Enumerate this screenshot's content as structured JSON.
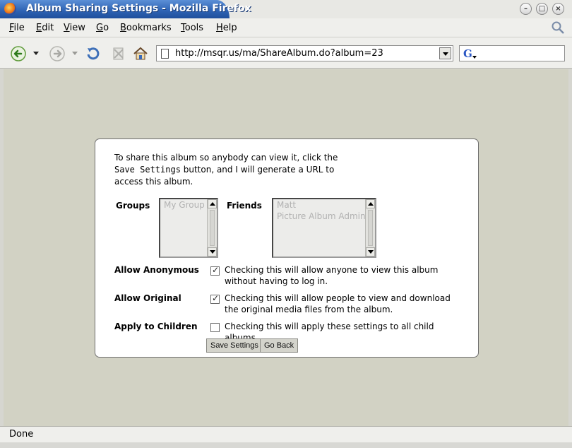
{
  "window": {
    "title": "Album Sharing Settings - Mozilla Firefox",
    "buttons": [
      "minimize",
      "maximize",
      "close"
    ]
  },
  "menubar": {
    "items": [
      {
        "label": "File",
        "key": "F",
        "rest": "ile"
      },
      {
        "label": "Edit",
        "key": "E",
        "rest": "dit"
      },
      {
        "label": "View",
        "key": "V",
        "rest": "iew"
      },
      {
        "label": "Go",
        "key": "G",
        "rest": "o"
      },
      {
        "label": "Bookmarks",
        "key": "B",
        "rest": "ookmarks"
      },
      {
        "label": "Tools",
        "key": "T",
        "rest": "ools"
      },
      {
        "label": "Help",
        "key": "H",
        "rest": "elp"
      }
    ]
  },
  "navbar": {
    "url": "http://msqr.us/ma/ShareAlbum.do?album=23",
    "search_value": ""
  },
  "panel": {
    "intro_pre": "To share this album so anybody can view it, click the ",
    "intro_code": "Save Settings",
    "intro_post": " button, and I will generate a URL to access this album.",
    "groups_label": "Groups",
    "groups_options": [
      "My Group"
    ],
    "friends_label": "Friends",
    "friends_options": [
      "Matt",
      "Picture Album Admin"
    ],
    "options": [
      {
        "label": "Allow Anonymous",
        "checked": true,
        "desc": "Checking this will allow anyone to view this album without having to log in."
      },
      {
        "label": "Allow Original",
        "checked": true,
        "desc": "Checking this will allow people to view and download the original media files from the album."
      },
      {
        "label": "Apply to Children",
        "checked": false,
        "desc": "Checking this will apply these settings to all child albums."
      }
    ],
    "save_button": "Save Settings",
    "back_button": "Go Back"
  },
  "statusbar": {
    "text": "Done"
  }
}
